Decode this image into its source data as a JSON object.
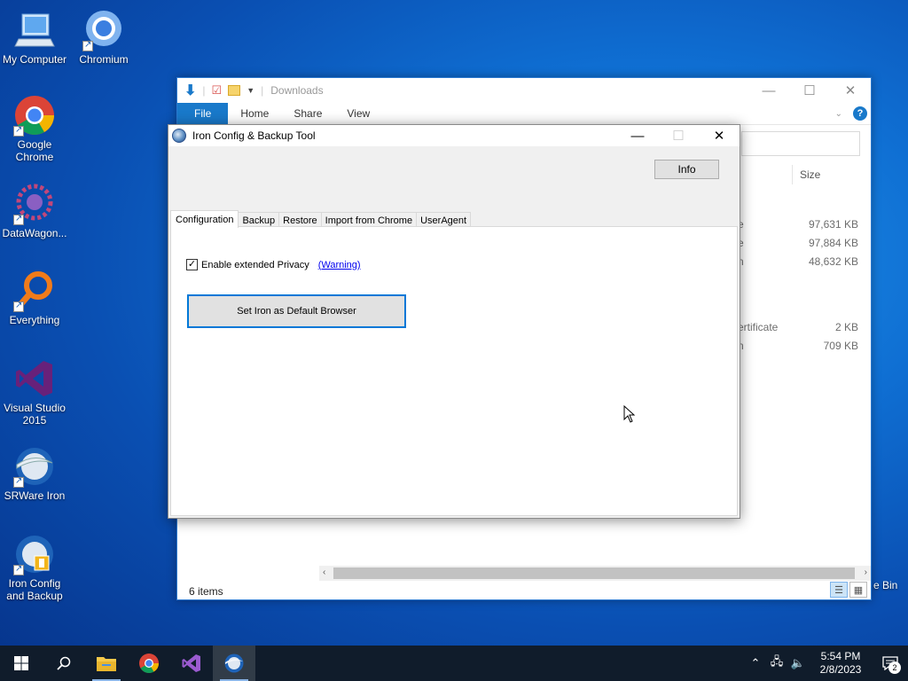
{
  "desktop": {
    "icons": [
      {
        "label": "My Computer",
        "icon": "computer-icon",
        "shortcut": false
      },
      {
        "label": "Chromium",
        "icon": "chromium-icon",
        "shortcut": true
      },
      {
        "label": "Google Chrome",
        "icon": "chrome-icon",
        "shortcut": true
      },
      {
        "label": "DataWagon...",
        "icon": "datawagon-icon",
        "shortcut": true
      },
      {
        "label": "Everything",
        "icon": "everything-icon",
        "shortcut": true
      },
      {
        "label": "Visual Studio 2015",
        "icon": "visual-studio-icon",
        "shortcut": false
      },
      {
        "label": "SRWare Iron",
        "icon": "srware-iron-icon",
        "shortcut": true
      },
      {
        "label": "Iron Config and Backup",
        "icon": "iron-config-icon",
        "shortcut": true
      }
    ],
    "recycle_bin_label": "e Bin"
  },
  "explorer": {
    "title": "Downloads",
    "ribbon_tabs": [
      "File",
      "Home",
      "Share",
      "View"
    ],
    "column_size": "Size",
    "rows": [
      {
        "name_fragment": "e",
        "size": "97,631 KB"
      },
      {
        "name_fragment": "e",
        "size": "97,884 KB"
      },
      {
        "name_fragment": "n",
        "size": "48,632 KB"
      },
      {
        "name_fragment": "ertificate",
        "size": "2 KB"
      },
      {
        "name_fragment": "n",
        "size": "709 KB"
      }
    ],
    "status": "6 items"
  },
  "dialog": {
    "title": "Iron Config & Backup Tool",
    "info_button": "Info",
    "tabs": [
      "Configuration",
      "Backup",
      "Restore",
      "Import from Chrome",
      "UserAgent"
    ],
    "active_tab": "Configuration",
    "privacy_checkbox_label": "Enable extended Privacy",
    "privacy_checked": true,
    "warning_link": "(Warning)",
    "default_browser_button": "Set Iron as Default Browser"
  },
  "taskbar": {
    "time": "5:54 PM",
    "date": "2/8/2023",
    "notification_count": "2"
  },
  "colors": {
    "accent": "#1979ca",
    "focus_border": "#0078d7",
    "taskbar": "#101c2b"
  }
}
